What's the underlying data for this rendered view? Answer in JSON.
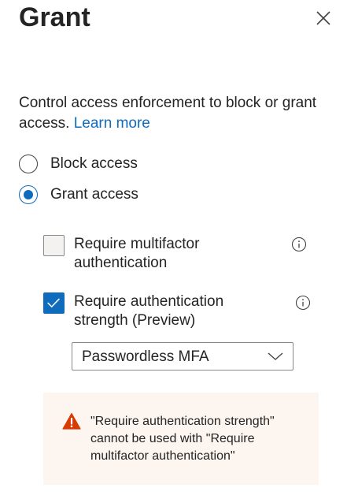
{
  "panel": {
    "title": "Grant"
  },
  "description": {
    "text": "Control access enforcement to block or grant access. ",
    "link_label": "Learn more"
  },
  "access_options": [
    {
      "label": "Block access",
      "selected": false
    },
    {
      "label": "Grant access",
      "selected": true
    }
  ],
  "controls": [
    {
      "label": "Require multifactor authentication",
      "checked": false,
      "icon": "info-icon"
    },
    {
      "label": "Require authentication strength (Preview)",
      "checked": true,
      "icon": "info-icon"
    }
  ],
  "strength_dropdown": {
    "selected_value": "Passwordless MFA"
  },
  "warning": {
    "text": "\"Require authentication strength\" cannot be used with \"Require multifactor authentication\"",
    "icon": "warning-icon"
  },
  "colors": {
    "accent": "#0f6cbd",
    "warning_bg": "#fdf6f0",
    "warning_icon": "#d83b01"
  }
}
